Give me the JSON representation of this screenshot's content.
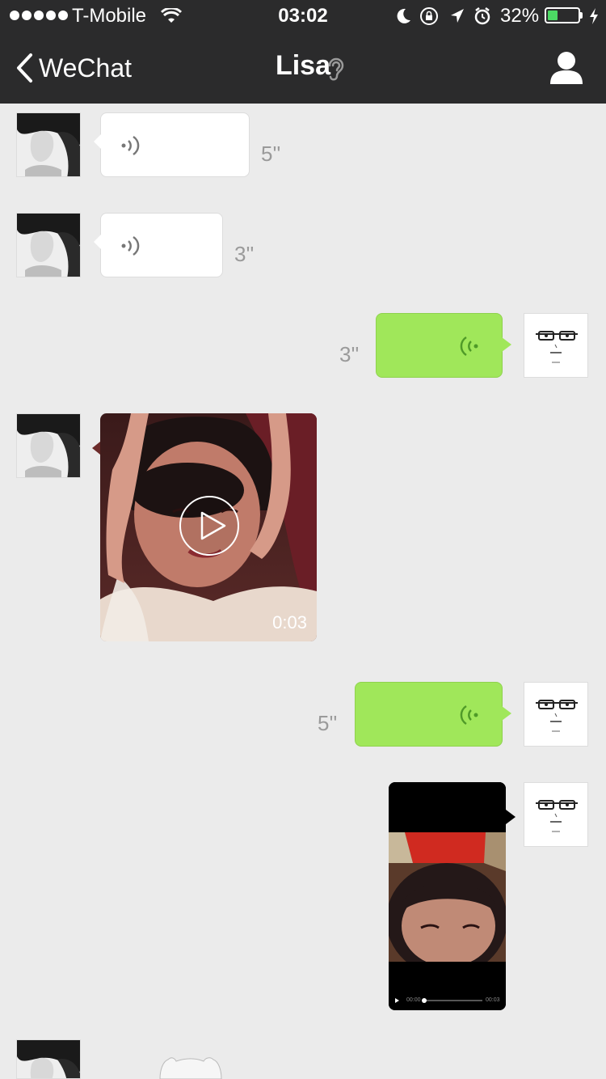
{
  "status_bar": {
    "carrier": "T-Mobile",
    "time": "03:02",
    "battery_percent": "32%",
    "battery_level": 0.32,
    "icons": [
      "signal-dots-icon",
      "wifi-icon",
      "moon-icon",
      "rotation-lock-icon",
      "location-arrow-icon",
      "alarm-icon",
      "battery-icon",
      "charging-bolt-icon"
    ]
  },
  "nav": {
    "back_label": "WeChat",
    "title": "Lisa",
    "icons": [
      "chevron-left-icon",
      "ear-icon",
      "contact-profile-icon"
    ]
  },
  "messages": [
    {
      "sender": "Lisa",
      "type": "voice",
      "duration": "5''"
    },
    {
      "sender": "Lisa",
      "type": "voice",
      "duration": "3''"
    },
    {
      "sender": "me",
      "type": "voice",
      "duration": "3''"
    },
    {
      "sender": "Lisa",
      "type": "video",
      "length": "0:03"
    },
    {
      "sender": "me",
      "type": "voice",
      "duration": "5''"
    },
    {
      "sender": "me",
      "type": "video",
      "player_time_left": "00:00",
      "player_time_right": "00:03"
    },
    {
      "sender": "Lisa",
      "type": "sticker"
    }
  ],
  "colors": {
    "header": "#2b2b2c",
    "chat_bg": "#ebebeb",
    "out_bubble": "#a0e75a",
    "in_bubble": "#ffffff"
  }
}
